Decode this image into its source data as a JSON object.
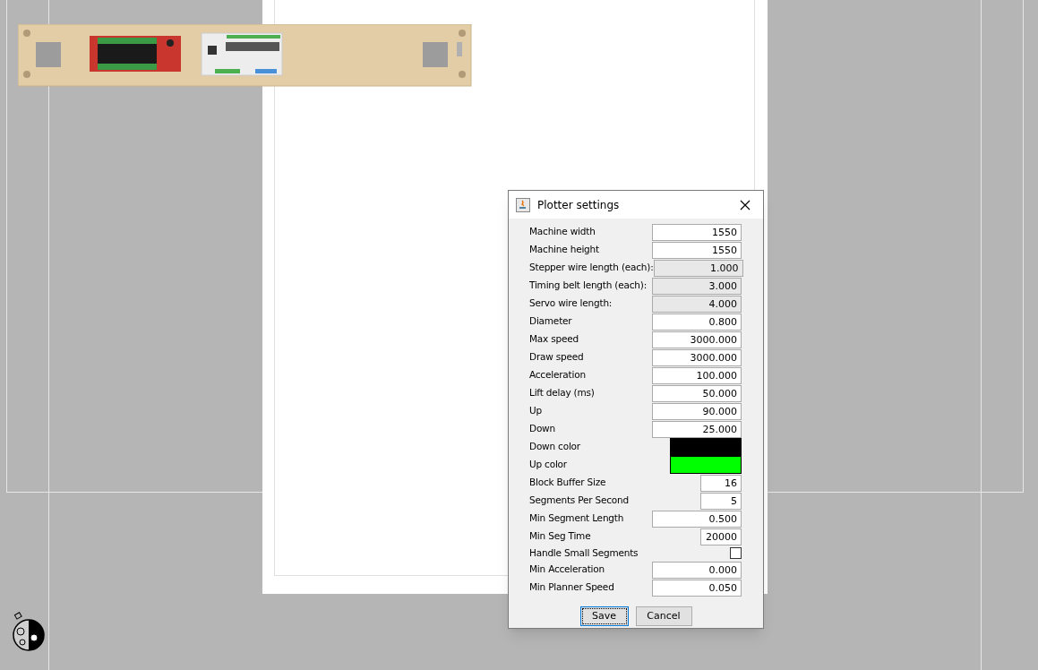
{
  "dialog": {
    "title": "Plotter settings",
    "fields": [
      {
        "label": "Machine width",
        "kind": "number",
        "value": "1550",
        "editable": true
      },
      {
        "label": "Machine height",
        "kind": "number",
        "value": "1550",
        "editable": true
      },
      {
        "label": "Stepper wire length (each):",
        "kind": "number",
        "value": "1.000",
        "editable": false
      },
      {
        "label": "Timing belt length (each):",
        "kind": "number",
        "value": "3.000",
        "editable": false
      },
      {
        "label": "Servo wire length:",
        "kind": "number",
        "value": "4.000",
        "editable": false
      },
      {
        "label": "Diameter",
        "kind": "number",
        "value": "0.800",
        "editable": true
      },
      {
        "label": "Max speed",
        "kind": "number",
        "value": "3000.000",
        "editable": true
      },
      {
        "label": "Draw speed",
        "kind": "number",
        "value": "3000.000",
        "editable": true
      },
      {
        "label": "Acceleration",
        "kind": "number",
        "value": "100.000",
        "editable": true
      },
      {
        "label": "Lift delay (ms)",
        "kind": "number",
        "value": "50.000",
        "editable": true
      },
      {
        "label": "Up",
        "kind": "number",
        "value": "90.000",
        "editable": true
      },
      {
        "label": "Down",
        "kind": "number",
        "value": "25.000",
        "editable": true
      },
      {
        "label": "Down color",
        "kind": "color",
        "color": "#000000"
      },
      {
        "label": "Up color",
        "kind": "color",
        "color": "#00ff00"
      },
      {
        "label": "Block Buffer Size",
        "kind": "integer",
        "value": "16",
        "editable": true
      },
      {
        "label": "Segments Per Second",
        "kind": "integer",
        "value": "5",
        "editable": true
      },
      {
        "label": "Min Segment Length",
        "kind": "number",
        "value": "0.500",
        "editable": true
      },
      {
        "label": "Min Seg Time",
        "kind": "integer",
        "value": "20000",
        "editable": true
      },
      {
        "label": "Handle Small Segments",
        "kind": "checkbox",
        "checked": false
      },
      {
        "label": "Min Acceleration",
        "kind": "number",
        "value": "0.000",
        "editable": true
      },
      {
        "label": "Min Planner Speed",
        "kind": "number",
        "value": "0.050",
        "editable": true
      }
    ],
    "buttons": [
      {
        "label": "Save",
        "focused": true
      },
      {
        "label": "Cancel",
        "focused": false
      }
    ]
  }
}
